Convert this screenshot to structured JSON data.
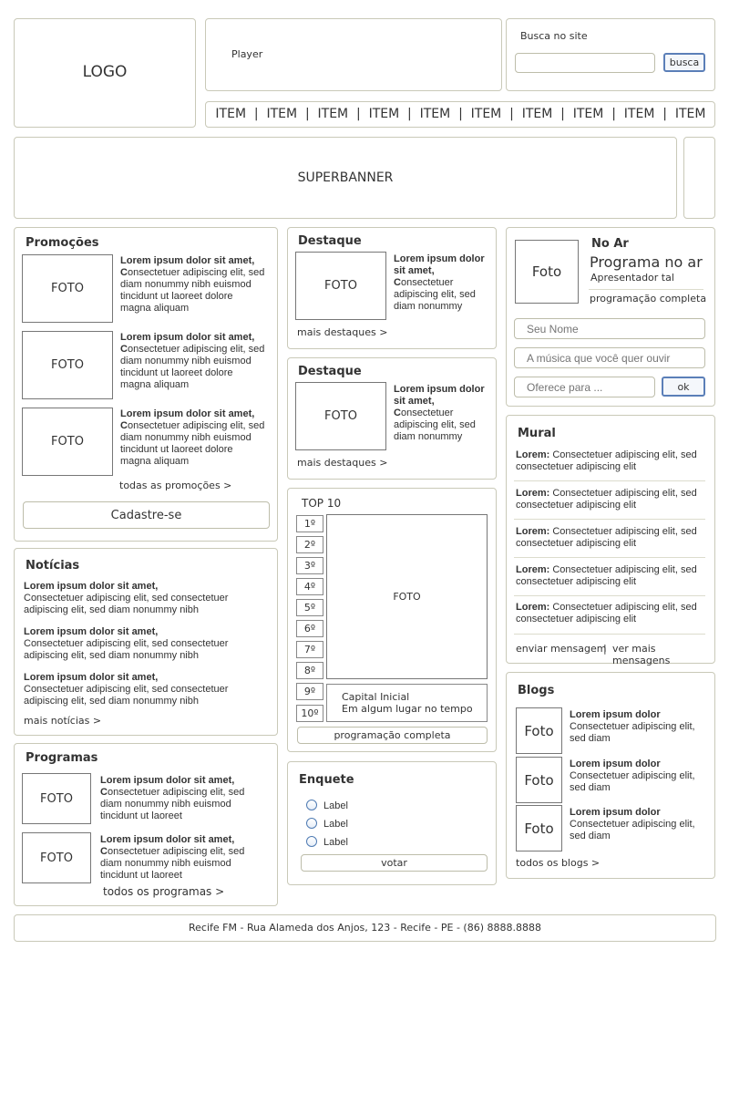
{
  "header": {
    "logo": "LOGO",
    "player": "Player",
    "search_label": "Busca no site",
    "search_value": "",
    "search_button": "busca"
  },
  "nav": {
    "items": [
      "ITEM",
      "ITEM",
      "ITEM",
      "ITEM",
      "ITEM",
      "ITEM",
      "ITEM",
      "ITEM",
      "ITEM",
      "ITEM"
    ],
    "separator": "|"
  },
  "superbanner": "SUPERBANNER",
  "photo_label": "FOTO",
  "promocoes": {
    "title": "Promoções",
    "items": [
      {
        "bold": "Lorem ipsum dolor sit amet,",
        "first": "C",
        "text": "onsectetuer adipiscing elit, sed diam nonummy nibh euismod tincidunt ut laoreet dolore magna aliquam"
      },
      {
        "bold": "Lorem ipsum dolor sit amet,",
        "first": "C",
        "text": "onsectetuer adipiscing elit, sed diam nonummy nibh euismod tincidunt ut laoreet dolore magna aliquam"
      },
      {
        "bold": "Lorem ipsum dolor sit amet,",
        "first": "C",
        "text": "onsectetuer adipiscing elit, sed diam nonummy nibh euismod tincidunt ut laoreet dolore magna aliquam"
      }
    ],
    "more": "todas as promoções >",
    "signup": "Cadastre-se"
  },
  "noticias": {
    "title": "Notícias",
    "items": [
      {
        "bold": "Lorem ipsum dolor sit amet,",
        "text": "Consectetuer adipiscing elit, sed consectetuer adipiscing elit, sed diam nonummy nibh"
      },
      {
        "bold": "Lorem ipsum dolor sit amet,",
        "text": "Consectetuer adipiscing elit, sed consectetuer adipiscing elit, sed diam nonummy nibh"
      },
      {
        "bold": "Lorem ipsum dolor sit amet,",
        "text": "Consectetuer adipiscing elit, sed consectetuer adipiscing elit, sed diam nonummy nibh"
      }
    ],
    "more": "mais notícias >"
  },
  "programas": {
    "title": "Programas",
    "items": [
      {
        "bold": "Lorem ipsum dolor sit amet,",
        "first": "C",
        "text": "onsectetuer adipiscing elit, sed diam nonummy nibh euismod tincidunt ut laoreet"
      },
      {
        "bold": "Lorem ipsum dolor sit amet,",
        "first": "C",
        "text": "onsectetuer adipiscing elit, sed diam nonummy nibh euismod tincidunt ut laoreet"
      }
    ],
    "more": "todos os programas >"
  },
  "destaques": [
    {
      "title": "Destaque",
      "bold": "Lorem ipsum dolor sit amet,",
      "first": "C",
      "text": "onsectetuer adipiscing elit, sed diam nonummy",
      "more": "mais destaques >"
    },
    {
      "title": "Destaque",
      "bold": "Lorem ipsum dolor sit amet,",
      "first": "C",
      "text": "onsectetuer adipiscing elit, sed diam nonummy",
      "more": "mais destaques >"
    }
  ],
  "top10": {
    "title": "TOP 10",
    "ranks": [
      "1º",
      "2º",
      "3º",
      "4º",
      "5º",
      "6º",
      "7º",
      "8º",
      "9º",
      "10º"
    ],
    "artist": "Capital Inicial",
    "song": "Em algum lugar no tempo",
    "button": "programação completa"
  },
  "enquete": {
    "title": "Enquete",
    "options": [
      "Label",
      "Label",
      "Label"
    ],
    "button": "votar"
  },
  "no_ar": {
    "photo": "Foto",
    "title": "No Ar",
    "program": "Programa no ar",
    "host": "Apresentador tal",
    "link": "programação completa",
    "name_placeholder": "Seu Nome",
    "song_placeholder": "A música que você quer ouvir",
    "to_placeholder": "Oferece para ...",
    "ok": "ok"
  },
  "mural": {
    "title": "Mural",
    "items": [
      {
        "bold": "Lorem:",
        "text": "Consectetuer adipiscing elit, sed consectetuer adipiscing elit"
      },
      {
        "bold": "Lorem:",
        "text": "Consectetuer adipiscing elit, sed consectetuer adipiscing elit"
      },
      {
        "bold": "Lorem:",
        "text": "Consectetuer adipiscing elit, sed consectetuer adipiscing elit"
      },
      {
        "bold": "Lorem:",
        "text": "Consectetuer adipiscing elit, sed consectetuer adipiscing elit"
      },
      {
        "bold": "Lorem:",
        "text": "Consectetuer adipiscing elit, sed consectetuer adipiscing elit"
      }
    ],
    "send": "enviar mensagem",
    "separator": "|",
    "more": "ver mais mensagens"
  },
  "blogs": {
    "title": "Blogs",
    "photo": "Foto",
    "items": [
      {
        "bold": "Lorem ipsum dolor",
        "text": "Consectetuer adipiscing elit, sed diam"
      },
      {
        "bold": "Lorem ipsum dolor",
        "text": "Consectetuer adipiscing elit, sed diam"
      },
      {
        "bold": "Lorem ipsum dolor",
        "text": "Consectetuer adipiscing elit, sed diam"
      }
    ],
    "more": "todos os blogs >"
  },
  "footer": "Recife FM - Rua Alameda dos Anjos, 123 - Recife - PE - (86) 8888.8888"
}
